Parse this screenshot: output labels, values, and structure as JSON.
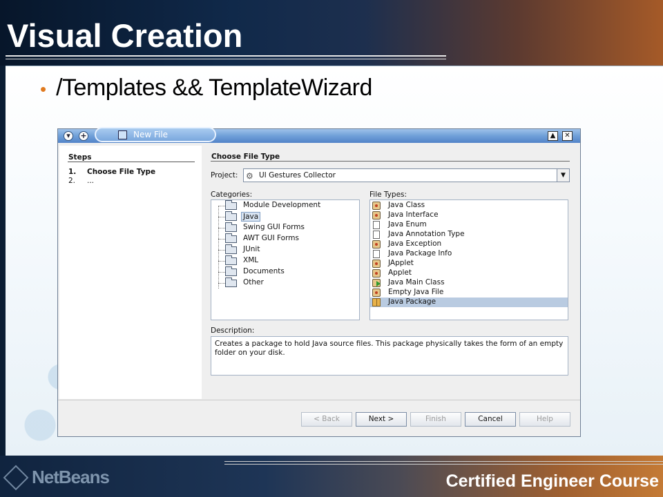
{
  "slide": {
    "title": "Visual Creation",
    "bullet": "/Templates && TemplateWizard",
    "footer_course": "Certified Engineer Course",
    "logo_text": "NetBeans"
  },
  "dialog": {
    "title": "New File",
    "steps_header": "Steps",
    "steps": [
      {
        "num": "1.",
        "label": "Choose File Type"
      },
      {
        "num": "2.",
        "label": "..."
      }
    ],
    "main_header": "Choose File Type",
    "project_label": "Project:",
    "project_value": "UI Gestures Collector",
    "categories_label": "Categories:",
    "categories": [
      "Module Development",
      "Java",
      "Swing GUI Forms",
      "AWT GUI Forms",
      "JUnit",
      "XML",
      "Documents",
      "Other"
    ],
    "selected_category": "Java",
    "file_types_label": "File Types:",
    "file_types": [
      {
        "label": "Java Class",
        "icon": "java-class-icon"
      },
      {
        "label": "Java Interface",
        "icon": "java-class-icon"
      },
      {
        "label": "Java Enum",
        "icon": "document-icon"
      },
      {
        "label": "Java Annotation Type",
        "icon": "document-icon"
      },
      {
        "label": "Java Exception",
        "icon": "java-class-icon"
      },
      {
        "label": "Java Package Info",
        "icon": "document-icon"
      },
      {
        "label": "JApplet",
        "icon": "java-class-icon"
      },
      {
        "label": "Applet",
        "icon": "java-class-icon"
      },
      {
        "label": "Java Main Class",
        "icon": "java-main-class-icon"
      },
      {
        "label": "Empty Java File",
        "icon": "java-class-icon"
      },
      {
        "label": "Java Package",
        "icon": "package-icon"
      }
    ],
    "selected_file_type": "Java Package",
    "description_label": "Description:",
    "description": "Creates a package to hold Java source files. This package physically takes the form of an empty folder on your disk.",
    "buttons": {
      "back": "< Back",
      "next": "Next >",
      "finish": "Finish",
      "cancel": "Cancel",
      "help": "Help"
    }
  }
}
